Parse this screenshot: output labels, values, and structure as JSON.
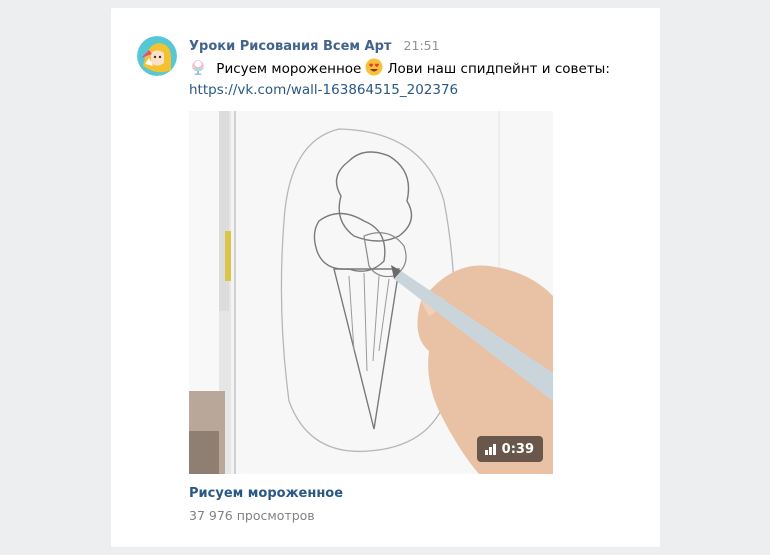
{
  "post": {
    "author": "Уроки Рисования Всем Арт",
    "time": "21:51",
    "text_part1": "Рисуем мороженное",
    "text_part2": "Лови наш спидпейнт и советы:",
    "link": "https://vk.com/wall-163864515_202376",
    "emoji_1": "ice-cream-emoji",
    "emoji_2": "heart-eyes-emoji"
  },
  "video": {
    "title": "Рисуем мороженное",
    "views": "37 976 просмотров",
    "duration": "0:39",
    "duration_icon": "bar-chart-icon"
  },
  "colors": {
    "background": "#edeef0",
    "card": "#ffffff",
    "author": "#42648b",
    "link": "#2a5885",
    "muted": "#828282"
  }
}
